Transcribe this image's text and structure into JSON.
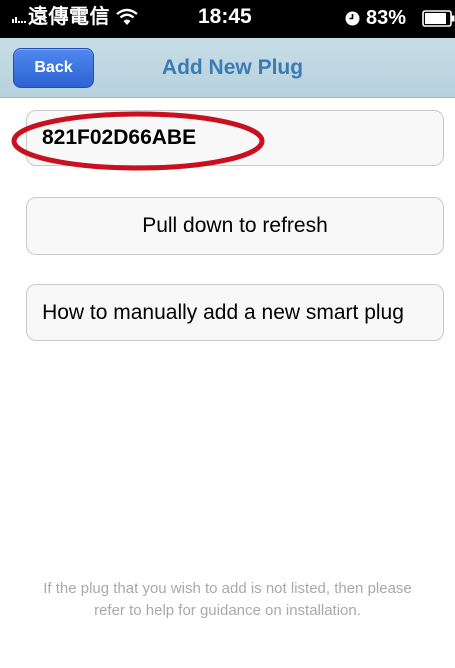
{
  "status_bar": {
    "carrier": "遠傳電信",
    "time": "18:45",
    "battery": "83%"
  },
  "nav": {
    "back_label": "Back",
    "title": "Add New Plug"
  },
  "plug_list": {
    "items": [
      {
        "id": "821F02D66ABE"
      }
    ]
  },
  "actions": {
    "refresh_label": "Pull down to refresh",
    "manual_add_label": "How to manually add a new smart plug"
  },
  "footer": {
    "note_line1": "If the plug that you wish to add is not listed, then please",
    "note_line2": "refer to help for guidance on installation."
  },
  "colors": {
    "back_button": "#2d63d3",
    "nav_title": "#3a7bb4",
    "highlight": "#c8101e"
  },
  "icons": {
    "signal": "signal-bars-icon",
    "wifi": "wifi-icon",
    "clock": "clock-icon",
    "battery": "battery-icon"
  }
}
